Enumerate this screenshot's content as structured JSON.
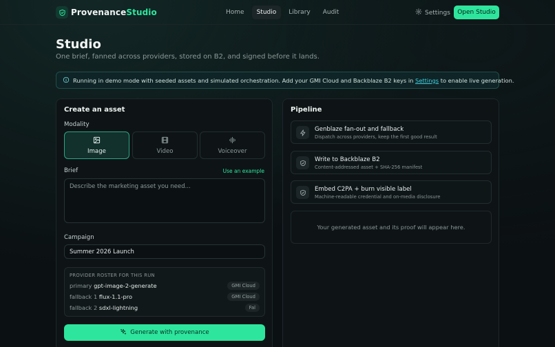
{
  "nav": {
    "brand_part1": "Provenance",
    "brand_part2": "Studio",
    "links": [
      "Home",
      "Studio",
      "Library",
      "Audit"
    ],
    "active_link": "Studio",
    "settings_label": "Settings",
    "cta_label": "Open Studio"
  },
  "header": {
    "title": "Studio",
    "subtitle": "One brief, fanned across providers, stored on B2, and signed before it lands."
  },
  "banner": {
    "text_before": "Running in demo mode with seeded assets and simulated orchestration. Add your GMI Cloud and Backblaze B2 keys in",
    "link": "Settings",
    "text_after": "to enable live generation."
  },
  "create": {
    "title": "Create an asset",
    "modality_label": "Modality",
    "modalities": [
      {
        "label": "Image",
        "icon": "image-icon",
        "active": true
      },
      {
        "label": "Video",
        "icon": "film-icon",
        "active": false
      },
      {
        "label": "Voiceover",
        "icon": "waveform-icon",
        "active": false
      }
    ],
    "brief_label": "Brief",
    "use_example": "Use an example",
    "brief_placeholder": "Describe the marketing asset you need...",
    "campaign_label": "Campaign",
    "campaign_value": "Summer 2026 Launch",
    "roster": {
      "heading": "PROVIDER ROSTER FOR THIS RUN",
      "rows": [
        {
          "role": "primary",
          "model": "gpt-image-2-generate",
          "provider": "GMI Cloud"
        },
        {
          "role": "fallback 1",
          "model": "flux-1.1-pro",
          "provider": "GMI Cloud"
        },
        {
          "role": "fallback 2",
          "model": "sdxl-lightning",
          "provider": "Fal"
        }
      ]
    },
    "generate_label": "Generate with provenance"
  },
  "pipeline": {
    "title": "Pipeline",
    "steps": [
      {
        "title": "Genblaze fan-out and fallback",
        "sub": "Dispatch across providers, keep the first good result",
        "icon": "zap-icon"
      },
      {
        "title": "Write to Backblaze B2",
        "sub": "Content-addressed asset + SHA-256 manifest",
        "icon": "shield-icon"
      },
      {
        "title": "Embed C2PA + burn visible label",
        "sub": "Machine-readable credential and on-media disclosure",
        "icon": "shield-icon"
      }
    ],
    "placeholder": "Your generated asset and its proof will appear here."
  },
  "colors": {
    "accent": "#2ee59d",
    "background": "#0b1012",
    "link": "#3fd0e0"
  }
}
